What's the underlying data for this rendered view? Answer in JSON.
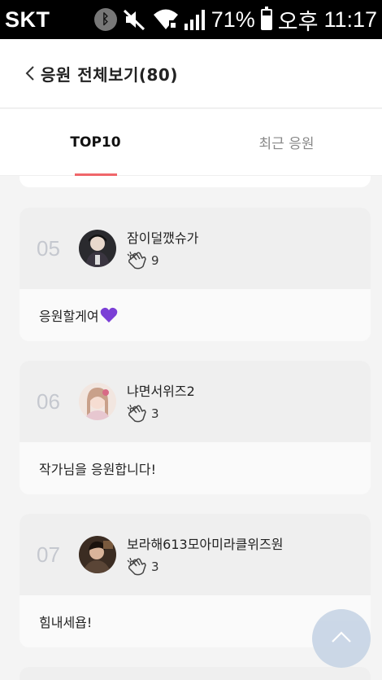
{
  "status_bar": {
    "carrier": "SKT",
    "battery": "71%",
    "battery_level": 0.71,
    "ampm": "오후",
    "time": "11:17",
    "icons": [
      "bluetooth-icon",
      "mute-icon",
      "wifi-icon",
      "signal-icon",
      "battery-icon"
    ]
  },
  "header": {
    "title": "응원 전체보기(80)"
  },
  "tabs": [
    {
      "label": "TOP10",
      "active": true
    },
    {
      "label": "최근 응원",
      "active": false
    }
  ],
  "cards": [
    {
      "rank": "05",
      "nickname": "잠이덜깼슈가",
      "cheer_count": "9",
      "message": "응원할게여",
      "has_heart": true
    },
    {
      "rank": "06",
      "nickname": "냐면서위즈2",
      "cheer_count": "3",
      "message": "작가님을 응원합니다!",
      "has_heart": false
    },
    {
      "rank": "07",
      "nickname": "보라해613모아미라클위즈원",
      "cheer_count": "3",
      "message": "힘내세욥!",
      "has_heart": false
    }
  ],
  "colors": {
    "accent": "#f0666a",
    "rank": "#c5c8cf",
    "heart": "#7b3fd6",
    "fab": "#c9d6e6"
  }
}
